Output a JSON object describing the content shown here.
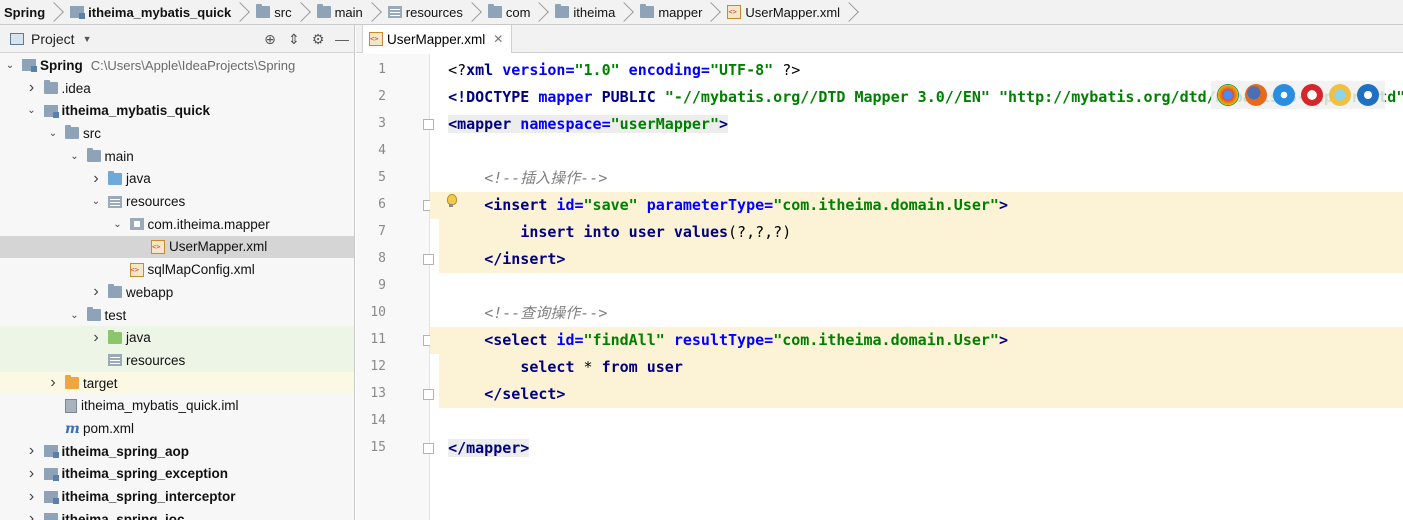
{
  "breadcrumb": [
    "Spring",
    "itheima_mybatis_quick",
    "src",
    "main",
    "resources",
    "com",
    "itheima",
    "mapper",
    "UserMapper.xml"
  ],
  "project_panel": {
    "title": "Project",
    "tree": [
      {
        "label": "Spring",
        "path": "C:\\Users\\Apple\\IdeaProjects\\Spring",
        "depth": 0,
        "arrow": "down",
        "icon": "module-folder-icon",
        "bold": true
      },
      {
        "label": ".idea",
        "depth": 1,
        "arrow": "right",
        "icon": "folder-icon"
      },
      {
        "label": "itheima_mybatis_quick",
        "depth": 1,
        "arrow": "down",
        "icon": "module-folder-icon",
        "bold": true
      },
      {
        "label": "src",
        "depth": 2,
        "arrow": "down",
        "icon": "folder-icon"
      },
      {
        "label": "main",
        "depth": 3,
        "arrow": "down",
        "icon": "folder-icon"
      },
      {
        "label": "java",
        "depth": 4,
        "arrow": "right",
        "icon": "source-folder-icon"
      },
      {
        "label": "resources",
        "depth": 4,
        "arrow": "down",
        "icon": "resources-folder-icon"
      },
      {
        "label": "com.itheima.mapper",
        "depth": 5,
        "arrow": "down",
        "icon": "package-icon"
      },
      {
        "label": "UserMapper.xml",
        "depth": 6,
        "arrow": "",
        "icon": "xml-file-icon",
        "selected": true
      },
      {
        "label": "sqlMapConfig.xml",
        "depth": 5,
        "arrow": "",
        "icon": "xml-file-icon"
      },
      {
        "label": "webapp",
        "depth": 4,
        "arrow": "right",
        "icon": "folder-icon"
      },
      {
        "label": "test",
        "depth": 3,
        "arrow": "down",
        "icon": "folder-icon"
      },
      {
        "label": "java",
        "depth": 4,
        "arrow": "right",
        "icon": "test-source-folder-icon",
        "bg": "green"
      },
      {
        "label": "resources",
        "depth": 4,
        "arrow": "",
        "icon": "test-resources-folder-icon",
        "bg": "green"
      },
      {
        "label": "target",
        "depth": 2,
        "arrow": "right",
        "icon": "excluded-folder-icon",
        "bg": "yellow"
      },
      {
        "label": "itheima_mybatis_quick.iml",
        "depth": 2,
        "arrow": "",
        "icon": "iml-file-icon"
      },
      {
        "label": "pom.xml",
        "depth": 2,
        "arrow": "",
        "icon": "maven-icon"
      },
      {
        "label": "itheima_spring_aop",
        "depth": 1,
        "arrow": "right",
        "icon": "module-folder-icon",
        "bold": true
      },
      {
        "label": "itheima_spring_exception",
        "depth": 1,
        "arrow": "right",
        "icon": "module-folder-icon",
        "bold": true
      },
      {
        "label": "itheima_spring_interceptor",
        "depth": 1,
        "arrow": "right",
        "icon": "module-folder-icon",
        "bold": true
      },
      {
        "label": "itheima_spring_ioc",
        "depth": 1,
        "arrow": "right",
        "icon": "module-folder-icon",
        "bold": true
      }
    ]
  },
  "editor": {
    "tab_label": "UserMapper.xml",
    "line_numbers": [
      "1",
      "2",
      "3",
      "4",
      "5",
      "6",
      "7",
      "8",
      "9",
      "10",
      "11",
      "12",
      "13",
      "14",
      "15"
    ],
    "lines": {
      "l1": {
        "a": "<?",
        "b": "xml",
        "c": " version=",
        "d": "\"1.0\"",
        "e": " encoding=",
        "f": "\"UTF-8\"",
        "g": " ?>"
      },
      "l2": {
        "a": "<!DOCTYPE ",
        "b": "mapper",
        "c": " PUBLIC ",
        "d": "\"-//mybatis.org//DTD Mapper 3.0//EN\"",
        "e": " \"http://mybatis.org/dtd/mybatis-3-mapper.dtd\""
      },
      "l3": {
        "a": "<mapper",
        "b": " namespace=",
        "c": "\"userMapper\"",
        "d": ">"
      },
      "l5": {
        "a": "<!--插入操作-->"
      },
      "l6": {
        "a": "<insert",
        "b": " id=",
        "c": "\"save\"",
        "d": " parameterType=",
        "e": "\"com.itheima.domain.User\"",
        "f": ">"
      },
      "l7": {
        "a": "insert into user values",
        "b": "(?,?,?)"
      },
      "l8": {
        "a": "</insert>"
      },
      "l10": {
        "a": "<!--查询操作-->"
      },
      "l11": {
        "a": "<select",
        "b": " id=",
        "c": "\"findAll\"",
        "d": " resultType=",
        "e": "\"com.itheima.domain.User\"",
        "f": ">"
      },
      "l12": {
        "a": "select ",
        "b": "*",
        "c": " from user"
      },
      "l13": {
        "a": "</select>"
      },
      "l15": {
        "a": "</mapper>"
      }
    }
  },
  "browser_icons": [
    "chrome-icon",
    "firefox-icon",
    "safari-icon",
    "opera-icon",
    "ie-icon",
    "edge-icon"
  ],
  "colors": {
    "highlight": "#fcf3d6",
    "tag": "#000080",
    "attr": "#0000ff",
    "value": "#008000",
    "comment": "#808080"
  }
}
